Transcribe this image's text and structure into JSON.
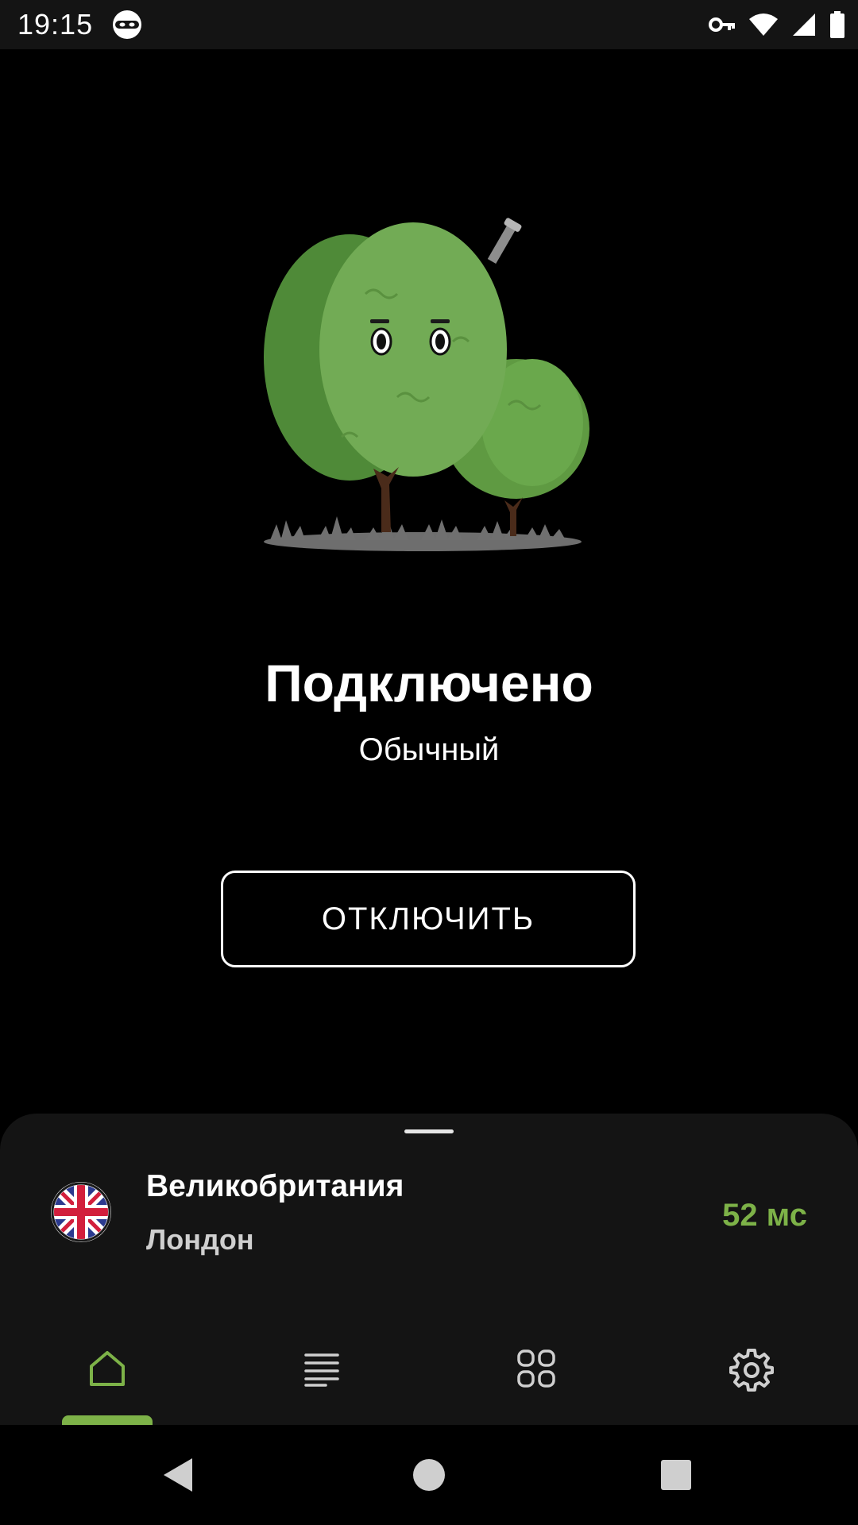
{
  "status_bar": {
    "time": "19:15",
    "left_icons": [
      "ninja-mask-icon"
    ],
    "right_icons": [
      "vpn-key-icon",
      "wifi-icon",
      "signal-icon",
      "battery-icon"
    ]
  },
  "hero": {
    "illustration": "bush-mascot-illustration"
  },
  "connection": {
    "status_title": "Подключено",
    "mode": "Обычный",
    "disconnect_label": "ОТКЛЮЧИТЬ"
  },
  "server": {
    "country": "Великобритания",
    "city": "Лондон",
    "latency": "52 мс",
    "flag_icon": "uk-flag-icon"
  },
  "tabs": [
    {
      "name": "home",
      "icon": "home-icon",
      "active": true
    },
    {
      "name": "list",
      "icon": "list-icon",
      "active": false
    },
    {
      "name": "apps",
      "icon": "grid-icon",
      "active": false
    },
    {
      "name": "settings",
      "icon": "gear-icon",
      "active": false
    }
  ],
  "colors": {
    "accent": "#7db248",
    "background": "#000000",
    "sheet": "#141414"
  }
}
